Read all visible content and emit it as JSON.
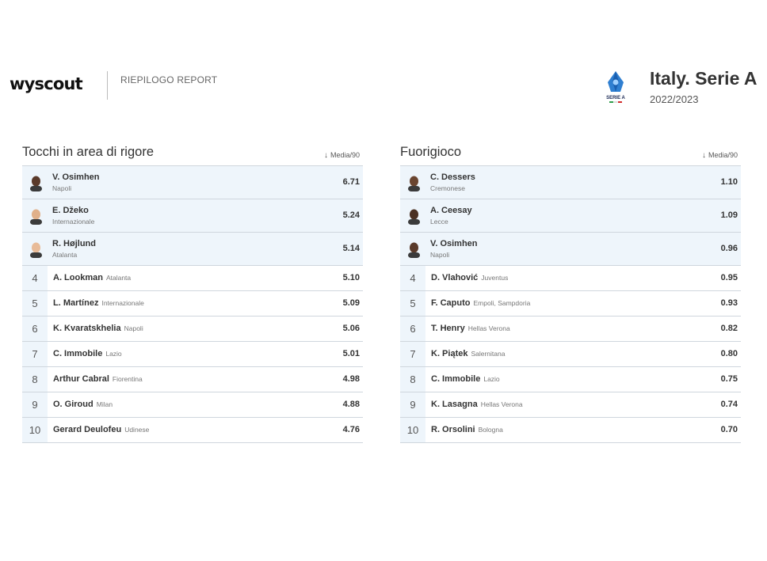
{
  "header": {
    "brand": "wyscout",
    "report_label": "RIEPILOGO REPORT",
    "league_name": "Italy. Serie A",
    "season": "2022/2023",
    "league_logo_text": "SERIE A"
  },
  "tables": [
    {
      "title": "Tocchi in area di rigore",
      "metric": "Media/90",
      "rows": [
        {
          "rank": "1",
          "name": "V. Osimhen",
          "team": "Napoli",
          "value": "6.71"
        },
        {
          "rank": "2",
          "name": "E. Džeko",
          "team": "Internazionale",
          "value": "5.24"
        },
        {
          "rank": "3",
          "name": "R. Højlund",
          "team": "Atalanta",
          "value": "5.14"
        },
        {
          "rank": "4",
          "name": "A. Lookman",
          "team": "Atalanta",
          "value": "5.10"
        },
        {
          "rank": "5",
          "name": "L. Martínez",
          "team": "Internazionale",
          "value": "5.09"
        },
        {
          "rank": "6",
          "name": "K. Kvaratskhelia",
          "team": "Napoli",
          "value": "5.06"
        },
        {
          "rank": "7",
          "name": "C. Immobile",
          "team": "Lazio",
          "value": "5.01"
        },
        {
          "rank": "8",
          "name": "Arthur Cabral",
          "team": "Fiorentina",
          "value": "4.98"
        },
        {
          "rank": "9",
          "name": "O. Giroud",
          "team": "Milan",
          "value": "4.88"
        },
        {
          "rank": "10",
          "name": "Gerard Deulofeu",
          "team": "Udinese",
          "value": "4.76"
        }
      ]
    },
    {
      "title": "Fuorigioco",
      "metric": "Media/90",
      "rows": [
        {
          "rank": "1",
          "name": "C. Dessers",
          "team": "Cremonese",
          "value": "1.10"
        },
        {
          "rank": "2",
          "name": "A. Ceesay",
          "team": "Lecce",
          "value": "1.09"
        },
        {
          "rank": "3",
          "name": "V. Osimhen",
          "team": "Napoli",
          "value": "0.96"
        },
        {
          "rank": "4",
          "name": "D. Vlahović",
          "team": "Juventus",
          "value": "0.95"
        },
        {
          "rank": "5",
          "name": "F. Caputo",
          "team": "Empoli, Sampdoria",
          "value": "0.93"
        },
        {
          "rank": "6",
          "name": "T. Henry",
          "team": "Hellas Verona",
          "value": "0.82"
        },
        {
          "rank": "7",
          "name": "K. Piątek",
          "team": "Salernitana",
          "value": "0.80"
        },
        {
          "rank": "8",
          "name": "C. Immobile",
          "team": "Lazio",
          "value": "0.75"
        },
        {
          "rank": "9",
          "name": "K. Lasagna",
          "team": "Hellas Verona",
          "value": "0.74"
        },
        {
          "rank": "10",
          "name": "R. Orsolini",
          "team": "Bologna",
          "value": "0.70"
        }
      ]
    }
  ],
  "avatar_skin_colors": [
    [
      "#5a3a2a",
      "#e0b08a",
      "#e8bb98"
    ],
    [
      "#6a4530",
      "#4a3022",
      "#5a3a2a"
    ]
  ]
}
